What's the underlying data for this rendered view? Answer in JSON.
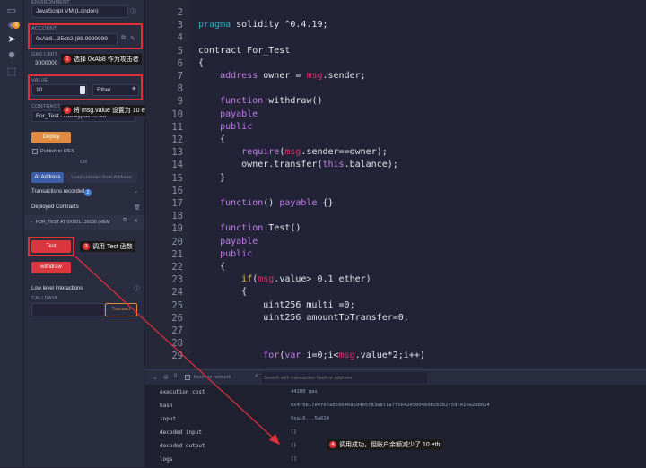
{
  "rail": {
    "badge_count": "3"
  },
  "panel": {
    "environment_label": "ENVIRONMENT",
    "environment_value": "JavaScript VM (London)",
    "account_label": "ACCOUNT",
    "account_value": "0xAb8...35cb2 (89.9999999",
    "gas_label": "GAS LIMIT",
    "gas_value": "3000000",
    "value_label": "VALUE",
    "value_amount": "10",
    "value_unit": "Ether",
    "contract_label": "CONTRACT",
    "contract_value": "For_Test - Honeypot/10.sol",
    "deploy_label": "Deploy",
    "publish_label": "Publish to IPFS",
    "or_label": "OR",
    "at_address_label": "At Address",
    "load_contract_label": "Load contract from Address",
    "transactions_label": "Transactions recorded",
    "transactions_count": "2",
    "deployed_label": "Deployed Contracts",
    "instance_label": "FOR_TEST AT 0XD91...39138 (MEM",
    "test_label": "Test",
    "withdraw_label": "withdraw",
    "low_level_label": "Low level interactions",
    "calldata_label": "CALLDATA",
    "transact_label": "Transact"
  },
  "annotations": [
    {
      "num": "1",
      "text": "选择 0xAb8 作为攻击者"
    },
    {
      "num": "2",
      "text": "将 msg.value 设置为 10 eth"
    },
    {
      "num": "3",
      "text": "调用 Test 函数"
    },
    {
      "num": "4",
      "text": "调用成功，但账户余额减少了 10 eth"
    }
  ],
  "editor": {
    "line_numbers": [
      "2",
      "3",
      "4",
      "5",
      "6",
      "7",
      "8",
      "9",
      "10",
      "11",
      "12",
      "13",
      "14",
      "15",
      "16",
      "17",
      "18",
      "19",
      "20",
      "21",
      "22",
      "23",
      "24",
      "25",
      "26",
      "27",
      "28",
      "29"
    ],
    "lines": [
      "",
      "pragma solidity ^0.4.19;",
      "",
      "contract For_Test",
      "{",
      "    address owner = msg.sender;",
      "",
      "    function withdraw()",
      "    payable",
      "    public",
      "    {",
      "        require(msg.sender==owner);",
      "        owner.transfer(this.balance);",
      "    }",
      "",
      "    function() payable {}",
      "",
      "    function Test()",
      "    payable",
      "    public",
      "    {",
      "        if(msg.value> 0.1 ether)",
      "        {",
      "            uint256 multi =0;",
      "            uint256 amountToTransfer=0;",
      "",
      "",
      "            for(var i=0;i<msg.value*2;i++)"
    ]
  },
  "terminal": {
    "count": "0",
    "listen_label": "listen on network",
    "search_placeholder": "Search with transaction hash or address",
    "rows": [
      {
        "key": "execution cost",
        "value": "44200 gas"
      },
      {
        "key": "hash",
        "value": "0x4f6b17e4f07a850046859405f83a871a7fce42e5004606cb2b2f59ce10a288014"
      },
      {
        "key": "input",
        "value": "0xa16...5a624"
      },
      {
        "key": "decoded input",
        "value": "{}"
      },
      {
        "key": "decoded output",
        "value": "{}"
      },
      {
        "key": "logs",
        "value": "[]"
      }
    ]
  },
  "colors": {
    "accent_orange": "#e28a3f",
    "accent_red": "#d9363e",
    "annotation_red": "#e0303a",
    "keyword": "#c17de8"
  }
}
